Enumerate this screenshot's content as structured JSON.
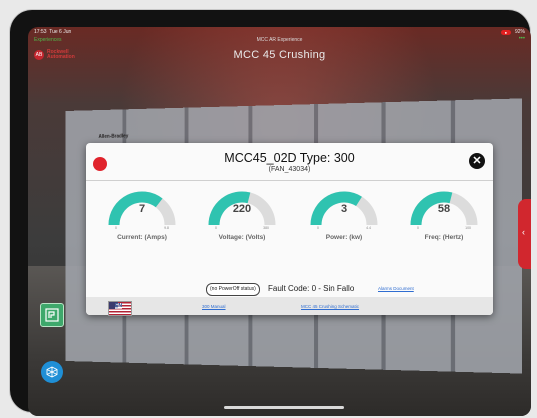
{
  "status_bar": {
    "time": "17:53",
    "date": "Tue 6 Jun",
    "recording_badge": "●",
    "battery": "92%"
  },
  "nav": {
    "back_label": "Experiences",
    "center_title": "MCC AR Experience",
    "more_label": "•••"
  },
  "brand": {
    "logo_text": "AB",
    "name": "Rockwell Automation"
  },
  "scene": {
    "title": "MCC 45 Crushing",
    "manufacturer": "Allen-Bradley"
  },
  "dialog": {
    "title": "MCC45_02D Type: 300",
    "subtitle": "(FAN_43034)",
    "status_color": "#e0232c",
    "close_icon": "close-icon",
    "gauges": [
      {
        "value": "7",
        "label": "Current: (Amps)",
        "min": "0",
        "max": "9.8",
        "fraction": 0.71
      },
      {
        "value": "220",
        "label": "Voltage: (Volts)",
        "min": "0",
        "max": "380",
        "fraction": 0.58
      },
      {
        "value": "3",
        "label": "Power: (kw)",
        "min": "0",
        "max": "4.4",
        "fraction": 0.68
      },
      {
        "value": "58",
        "label": "Freq: (Hertz)",
        "min": "0",
        "max": "100",
        "fraction": 0.58
      }
    ],
    "power_status": "(no PowerOff status)",
    "fault_text": "Fault Code: 0 - Sin Fallo",
    "alarms_link": "Alarms Document",
    "language": "EN",
    "manual_link": "300 Manual",
    "schematic_link": "MCC 45 Crushing Schematic"
  },
  "colors": {
    "accent": "#2fc3b0",
    "track": "#dcdcdc",
    "link": "#2f6dd1",
    "brand": "#c6262e"
  }
}
